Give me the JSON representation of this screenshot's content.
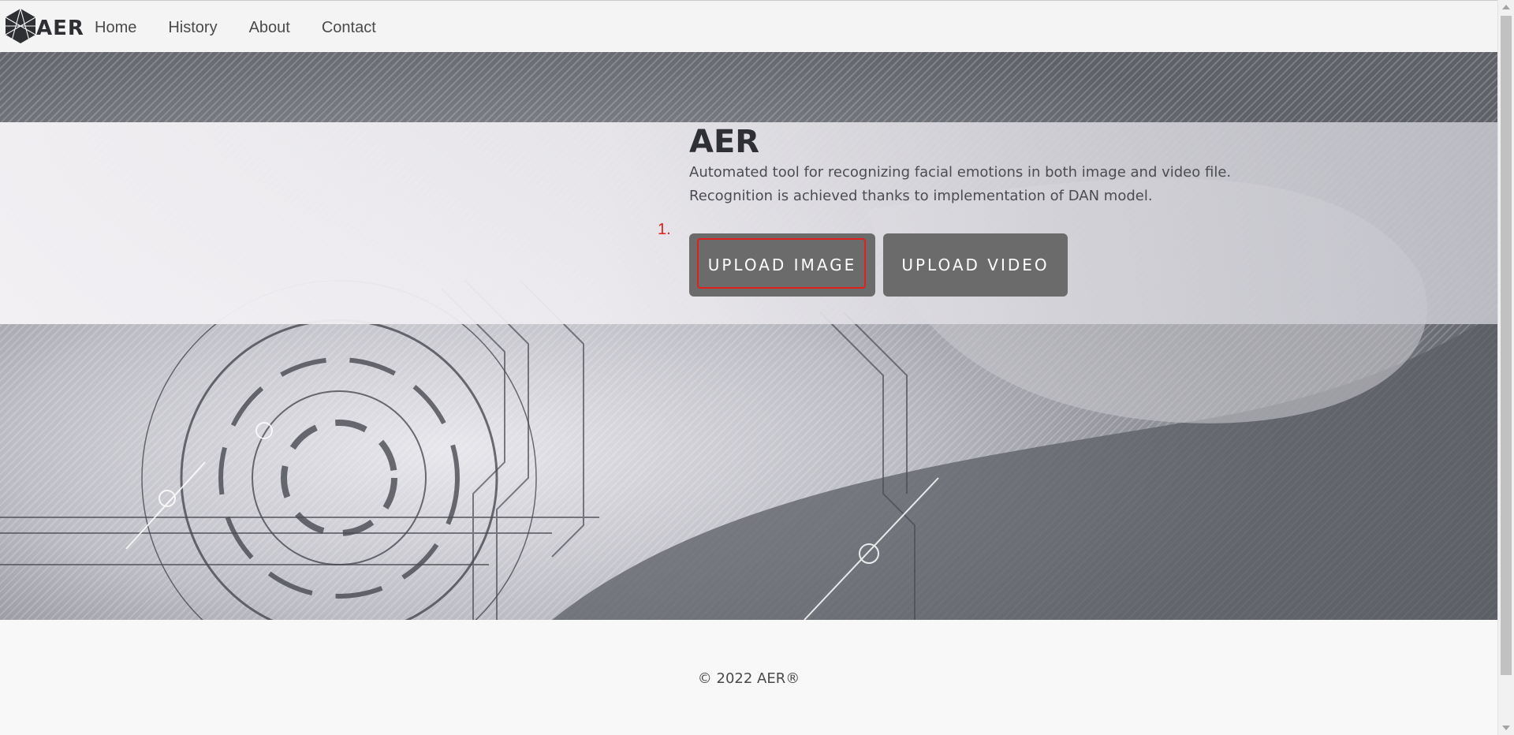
{
  "brand": {
    "name": "AER",
    "logo_icon": "hexagon-logo-icon"
  },
  "nav": {
    "items": [
      {
        "label": "Home"
      },
      {
        "label": "History"
      },
      {
        "label": "About"
      },
      {
        "label": "Contact"
      }
    ]
  },
  "hero": {
    "title": "AER",
    "description_line1": "Automated tool for recognizing facial emotions in both image and video file.",
    "description_line2": "Recognition is achieved thanks to implementation of DAN model.",
    "step_marker": "1.",
    "upload_image_label": "UPLOAD IMAGE",
    "upload_video_label": "UPLOAD VIDEO"
  },
  "footer": {
    "copyright": "© 2022 AER®"
  },
  "colors": {
    "button_bg": "#6b6b6b",
    "focus_ring": "#e0201c",
    "text_dark": "#2f3036"
  }
}
